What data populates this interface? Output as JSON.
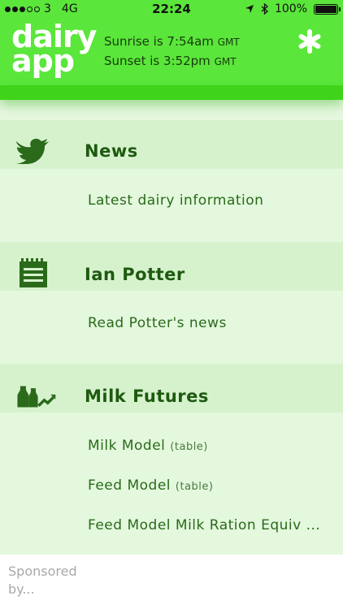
{
  "status_bar": {
    "carrier": "3",
    "network": "4G",
    "time": "22:24",
    "battery": "100%"
  },
  "header": {
    "logo_line1": "dairy",
    "logo_line2": "app",
    "sunrise_text": "Sunrise is 7:54am",
    "sunrise_tz": "GMT",
    "sunset_text": "Sunset is 3:52pm",
    "sunset_tz": "GMT",
    "settings_icon": "asterisk-icon"
  },
  "sections": [
    {
      "title": "News",
      "icon": "twitter-bird-icon",
      "items": [
        {
          "label": "Latest dairy information",
          "suffix": ""
        }
      ]
    },
    {
      "title": "Ian Potter",
      "icon": "notepad-icon",
      "items": [
        {
          "label": "Read Potter's news",
          "suffix": ""
        }
      ]
    },
    {
      "title": "Milk Futures",
      "icon": "milk-bottles-chart-icon",
      "items": [
        {
          "label": "Milk Model",
          "suffix": "(table)"
        },
        {
          "label": "Feed Model",
          "suffix": "(table)"
        },
        {
          "label": "Feed Model Milk Ration Equiv ...",
          "suffix": ""
        }
      ]
    }
  ],
  "sponsor": {
    "text": "Sponsored by..."
  },
  "colors": {
    "header_green": "#5ae63a",
    "band_green": "#3fd41a",
    "title_green": "#1e5a10",
    "item_green": "#2a6a1a",
    "background": "#e3f8dd"
  }
}
